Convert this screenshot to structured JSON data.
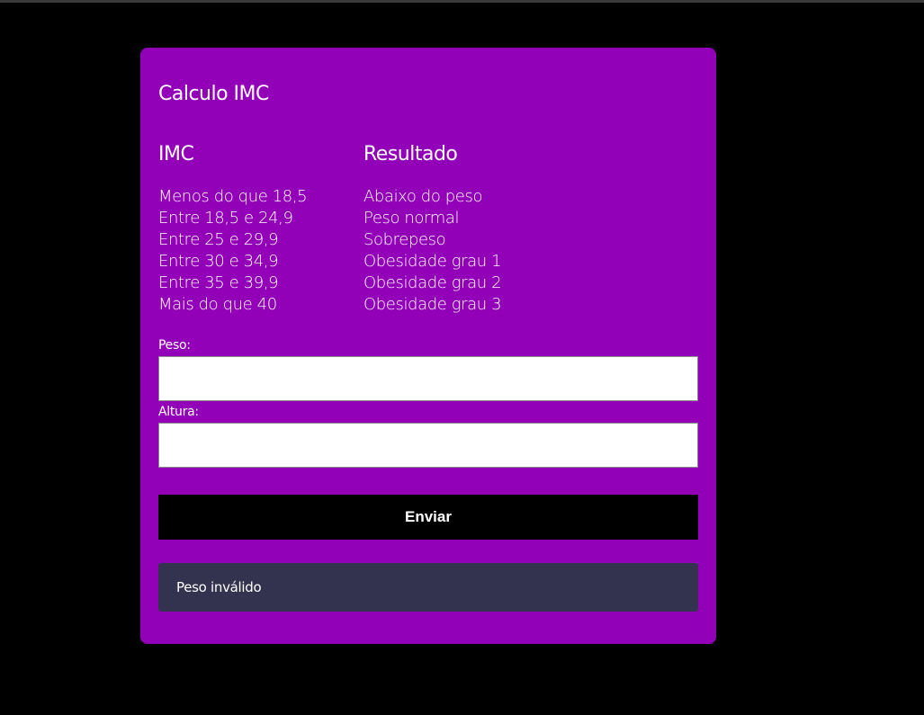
{
  "card": {
    "title": "Calculo IMC",
    "table": {
      "imc_header": "IMC",
      "result_header": "Resultado",
      "imc_ranges": [
        "Menos do que 18,5",
        "Entre 18,5 e 24,9",
        "Entre 25 e 29,9",
        "Entre 30 e 34,9",
        "Entre 35 e 39,9",
        "Mais do que 40"
      ],
      "results": [
        "Abaixo do peso",
        "Peso normal",
        "Sobrepeso",
        "Obesidade grau 1",
        "Obesidade grau 2",
        "Obesidade grau 3"
      ]
    },
    "form": {
      "peso_label": "Peso:",
      "peso_value": "",
      "altura_label": "Altura:",
      "altura_value": "",
      "submit_label": "Enviar"
    },
    "message": "Peso inválido"
  },
  "colors": {
    "page_background": "#000000",
    "card_background": "#9200b8",
    "button_background": "#000000",
    "message_background": "#33324f",
    "text": "#ffffff"
  }
}
